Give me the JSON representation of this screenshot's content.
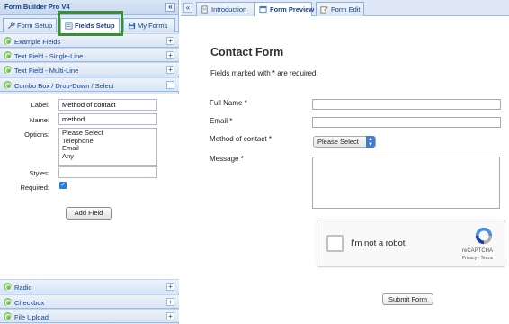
{
  "left_panel": {
    "title": "Form Builder Pro V4",
    "collapse_glyph": "«",
    "tabs": [
      {
        "label": "Form Setup",
        "icon": "wrench-icon"
      },
      {
        "label": "Fields Setup",
        "icon": "fields-icon"
      },
      {
        "label": "My Forms",
        "icon": "floppy-icon"
      }
    ],
    "sections_top": [
      {
        "label": "Example Fields",
        "toggle": "+"
      },
      {
        "label": "Text Field - Single-Line",
        "toggle": "+"
      },
      {
        "label": "Text Field - Multi-Line",
        "toggle": "+"
      },
      {
        "label": "Combo Box / Drop-Down / Select",
        "toggle": "−"
      }
    ],
    "field_form": {
      "label_label": "Label:",
      "label_value": "Method of contact",
      "name_label": "Name:",
      "name_value": "method",
      "options_label": "Options:",
      "options": [
        "Please Select",
        "Telephone",
        "Email",
        "Any"
      ],
      "styles_label": "Styles:",
      "styles_value": "",
      "required_label": "Required:",
      "required_checked": true,
      "add_button": "Add Field"
    },
    "sections_bottom": [
      {
        "label": "Radio",
        "toggle": "+"
      },
      {
        "label": "Checkbox",
        "toggle": "+"
      },
      {
        "label": "File Upload",
        "toggle": "+"
      }
    ]
  },
  "right_panel": {
    "chevron_glyph": "«",
    "tabs": [
      {
        "label": "Introduction",
        "icon": "document-icon"
      },
      {
        "label": "Form Preview",
        "icon": "preview-icon"
      },
      {
        "label": "Form Edit",
        "icon": "edit-icon"
      }
    ],
    "preview": {
      "title": "Contact Form",
      "required_note": "Fields marked with * are required.",
      "fields": {
        "full_name": "Full Name *",
        "email": "Email *",
        "method": "Method of contact *",
        "message": "Message *"
      },
      "select_value": "Please Select",
      "recaptcha": {
        "text": "I'm not a robot",
        "brand": "reCAPTCHA",
        "links": "Privacy - Terms"
      },
      "submit": "Submit Form"
    }
  },
  "colors": {
    "highlight": "#3b8f2f",
    "panel_bg": "#dfe8f6",
    "border": "#99bbe8",
    "header_text": "#15428b",
    "checkbox": "#2a7fd8"
  }
}
